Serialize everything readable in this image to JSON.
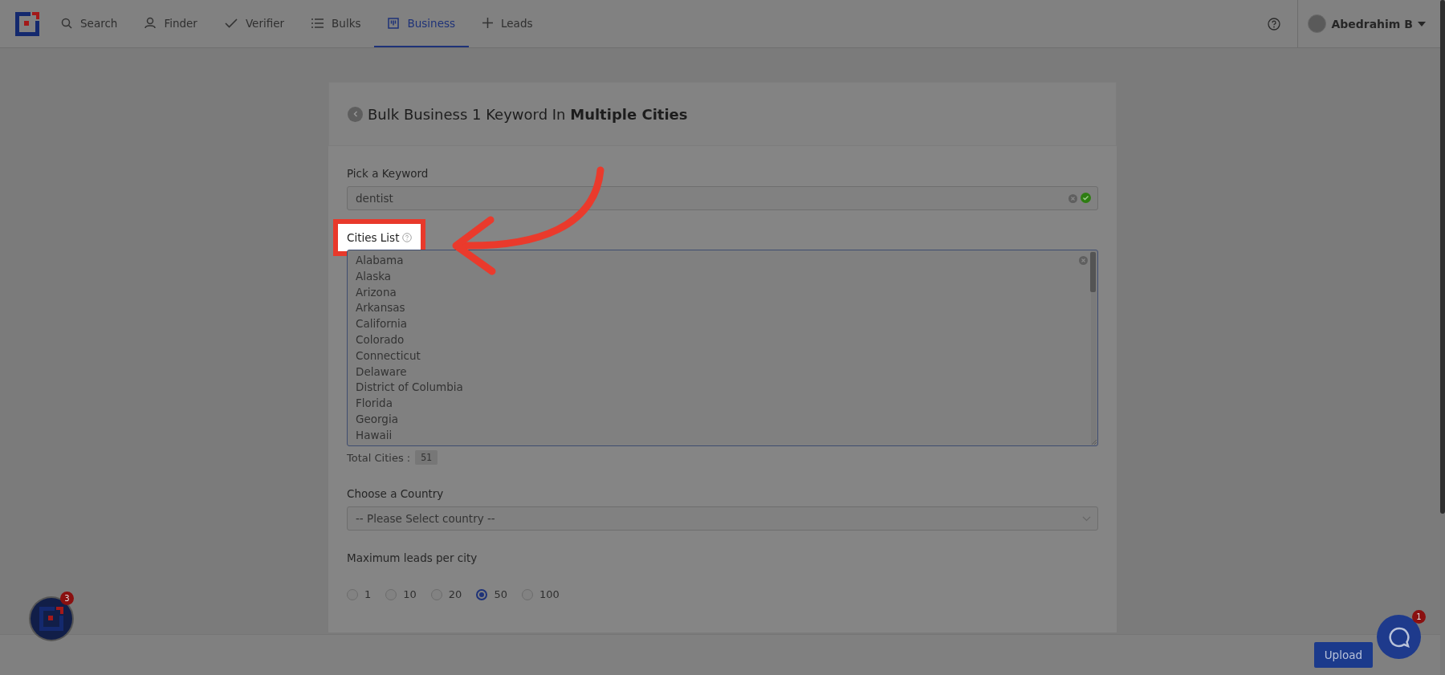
{
  "nav": {
    "items": [
      {
        "label": "Search",
        "kind": "search",
        "selected": false
      },
      {
        "label": "Finder",
        "kind": "person",
        "selected": false
      },
      {
        "label": "Verifier",
        "kind": "check",
        "selected": false
      },
      {
        "label": "Bulks",
        "kind": "list",
        "selected": false
      },
      {
        "label": "Business",
        "kind": "building",
        "selected": true
      },
      {
        "label": "Leads",
        "kind": "plus",
        "selected": false
      }
    ],
    "user": {
      "name": "Abedrahim B"
    }
  },
  "card": {
    "title": "Bulk Business 1 Keyword In **Multiple Cities**",
    "keyword": {
      "label": "Pick a Keyword",
      "value": "dentist",
      "valid": true
    },
    "cities": {
      "label": "Cities List",
      "highlighted": true,
      "lines": [
        "Alabama",
        "Alaska",
        "Arizona",
        "Arkansas",
        "California",
        "Colorado",
        "Connecticut",
        "Delaware",
        "District of Columbia",
        "Florida",
        "Georgia",
        "Hawaii"
      ],
      "total_label": "Total Cities :",
      "total_count": "51"
    },
    "country": {
      "label": "Choose a Country",
      "placeholder": "-- Please Select country --"
    },
    "max_leads": {
      "label": "Maximum leads per city",
      "options": [
        {
          "label": "1",
          "selected": false
        },
        {
          "label": "10",
          "selected": false
        },
        {
          "label": "20",
          "selected": false
        },
        {
          "label": "50",
          "selected": true
        },
        {
          "label": "100",
          "selected": false
        }
      ]
    }
  },
  "footer": {
    "button": "Upload"
  },
  "widgets": {
    "app_badge": "3",
    "chat_badge": "1"
  }
}
